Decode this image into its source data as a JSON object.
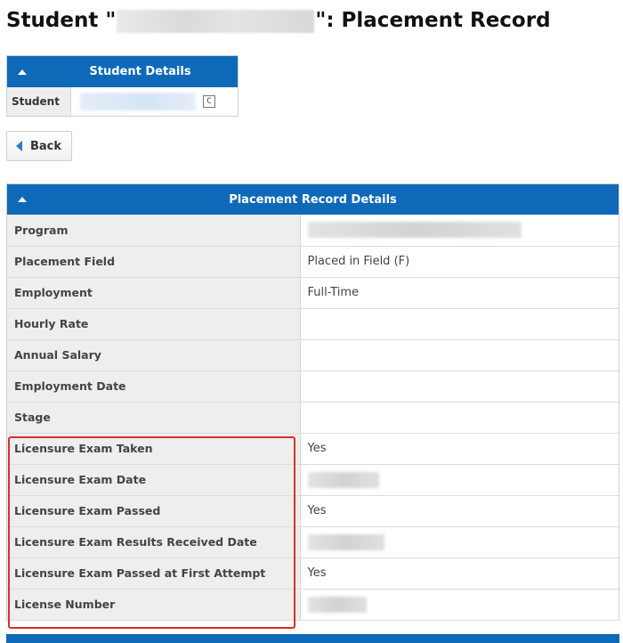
{
  "page": {
    "title_prefix": "Student \"",
    "title_suffix": "\": Placement Record"
  },
  "student_panel": {
    "title": "Student Details",
    "student_label": "Student",
    "copy_icon_glyph": "C"
  },
  "back_button": {
    "label": "Back"
  },
  "record_panel": {
    "title": "Placement Record Details",
    "rows": [
      {
        "label": "Program",
        "value": ""
      },
      {
        "label": "Placement Field",
        "value": "Placed in Field (F)"
      },
      {
        "label": "Employment",
        "value": "Full-Time"
      },
      {
        "label": "Hourly Rate",
        "value": ""
      },
      {
        "label": "Annual Salary",
        "value": ""
      },
      {
        "label": "Employment Date",
        "value": ""
      },
      {
        "label": "Stage",
        "value": ""
      },
      {
        "label": "Licensure Exam Taken",
        "value": "Yes"
      },
      {
        "label": "Licensure Exam Date",
        "value": ""
      },
      {
        "label": "Licensure Exam Passed",
        "value": "Yes"
      },
      {
        "label": "Licensure Exam Results Received Date",
        "value": ""
      },
      {
        "label": "Licensure Exam Passed at First Attempt",
        "value": "Yes"
      },
      {
        "label": "License Number",
        "value": ""
      }
    ]
  },
  "colors": {
    "header_blue": "#0e6ab8",
    "label_bg": "#eeeeee",
    "highlight_red": "#d9302d"
  }
}
